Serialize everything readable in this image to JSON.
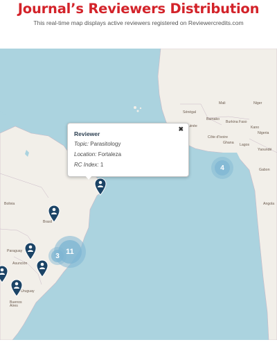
{
  "header": {
    "title": "Journal’s Reviewers Distribution",
    "subtitle": "This real-time map displays active reviewers registered on Reviewercredits.com"
  },
  "colors": {
    "title": "#d3232a",
    "ocean": "#abd3df",
    "land": "#f2efe9",
    "cluster": "#7fb6d3",
    "pin": "#1c4466"
  },
  "map": {
    "labels": {
      "mali": "Mali",
      "niger": "Niger",
      "senegal": "Sénégal",
      "guinea": "Guinée",
      "bamako": "Bamako",
      "burkina": "Burkina Faso",
      "kano": "Kano",
      "nigeria": "Nigeria",
      "cote": "Côte d'Ivoire",
      "ghana": "Ghana",
      "lagos": "Lagos",
      "yaounde": "Yaoundé",
      "gabon": "Gabon",
      "angola": "Angola",
      "brasil": "Brasil",
      "paraguay": "Paraguay",
      "asuncion": "Asunción",
      "uruguay": "Uruguay",
      "bsas": "Buenos Aires",
      "bolivia": "Bolivia"
    },
    "clusters": [
      {
        "id": "africa",
        "count": "4"
      },
      {
        "id": "rio",
        "count": "11"
      },
      {
        "id": "sao-paulo",
        "count": "3"
      }
    ],
    "pins_icon": "person-map-marker-icon"
  },
  "popup": {
    "heading": "Reviewer",
    "close": "✖",
    "topic_label": "Topic:",
    "topic_value": "Parasitology",
    "location_label": "Location:",
    "location_value": "Fortaleza",
    "rc_label": "RC Index:",
    "rc_value": "1"
  }
}
